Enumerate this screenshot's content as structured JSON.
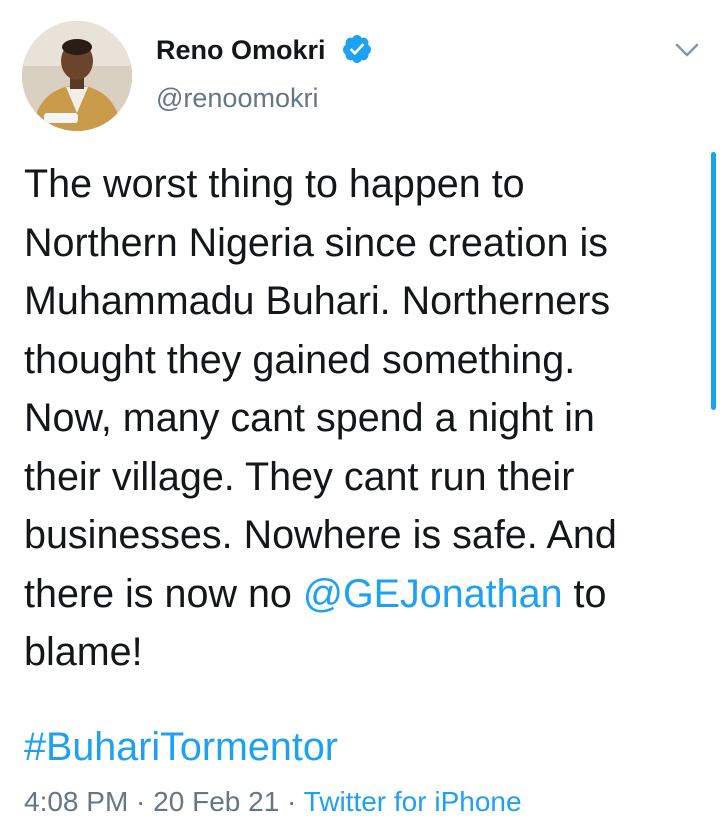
{
  "author": {
    "display_name": "Reno Omokri",
    "handle": "@renoomokri",
    "verified": true,
    "avatar_icon": "user-photo-avatar"
  },
  "tweet": {
    "lines": [
      "The worst thing to happen to",
      "Northern Nigeria since creation is",
      "Muhammadu Buhari. Northerners",
      "thought they gained something.",
      "Now, many cant spend a night in",
      "their village. They cant run their",
      "businesses. Nowhere is safe. And"
    ],
    "line8_before": "there is now no ",
    "mention": "@GEJonathan",
    "line8_after": " to",
    "last_line": "blame!",
    "hashtag": "#BuhariTormentor"
  },
  "meta": {
    "time": "4:08 PM",
    "sep1": " · ",
    "date": "20 Feb 21",
    "sep2": " · ",
    "source": "Twitter for iPhone"
  },
  "colors": {
    "link": "#1da1f2",
    "text": "#14171a",
    "muted": "#657786"
  },
  "icons": [
    "verified-badge-icon",
    "chevron-down-icon"
  ]
}
